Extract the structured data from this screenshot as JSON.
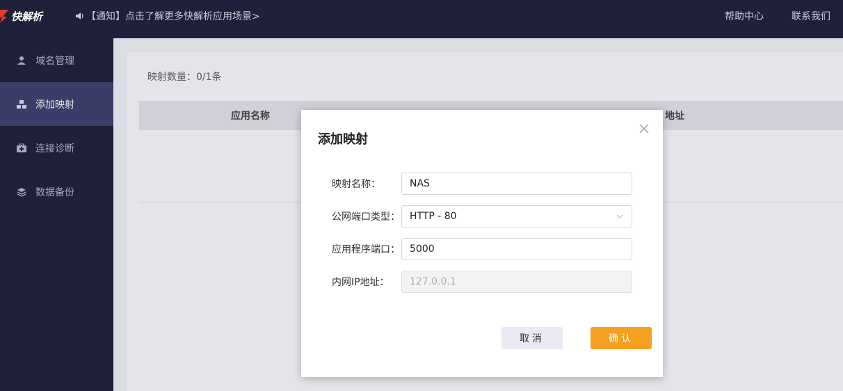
{
  "topbar": {
    "logo_text": "快解析",
    "notice": "【通知】点击了解更多快解析应用场景>",
    "links": [
      "帮助中心",
      "联系我们"
    ]
  },
  "sidebar": {
    "items": [
      {
        "label": "域名管理",
        "icon": "user-icon",
        "active": false
      },
      {
        "label": "添加映射",
        "icon": "network-icon",
        "active": true
      },
      {
        "label": "连接诊断",
        "icon": "medkit-icon",
        "active": false
      },
      {
        "label": "数据备份",
        "icon": "layers-icon",
        "active": false
      }
    ]
  },
  "main": {
    "count_label": "映射数量：",
    "count_value": "0/1条",
    "table_headers": [
      "应用名称",
      "地址"
    ]
  },
  "modal": {
    "title": "添加映射",
    "fields": [
      {
        "label": "映射名称：",
        "value": "NAS",
        "type": "input"
      },
      {
        "label": "公网端口类型：",
        "value": "HTTP - 80",
        "type": "select"
      },
      {
        "label": "应用程序端口：",
        "value": "5000",
        "type": "input"
      },
      {
        "label": "内网IP地址：",
        "value": "127.0.0.1",
        "type": "disabled"
      }
    ],
    "cancel_label": "取消",
    "ok_label": "确认"
  },
  "colors": {
    "nav_bg": "#1f2039",
    "nav_active": "#3a3d68",
    "accent": "#f6a021"
  }
}
